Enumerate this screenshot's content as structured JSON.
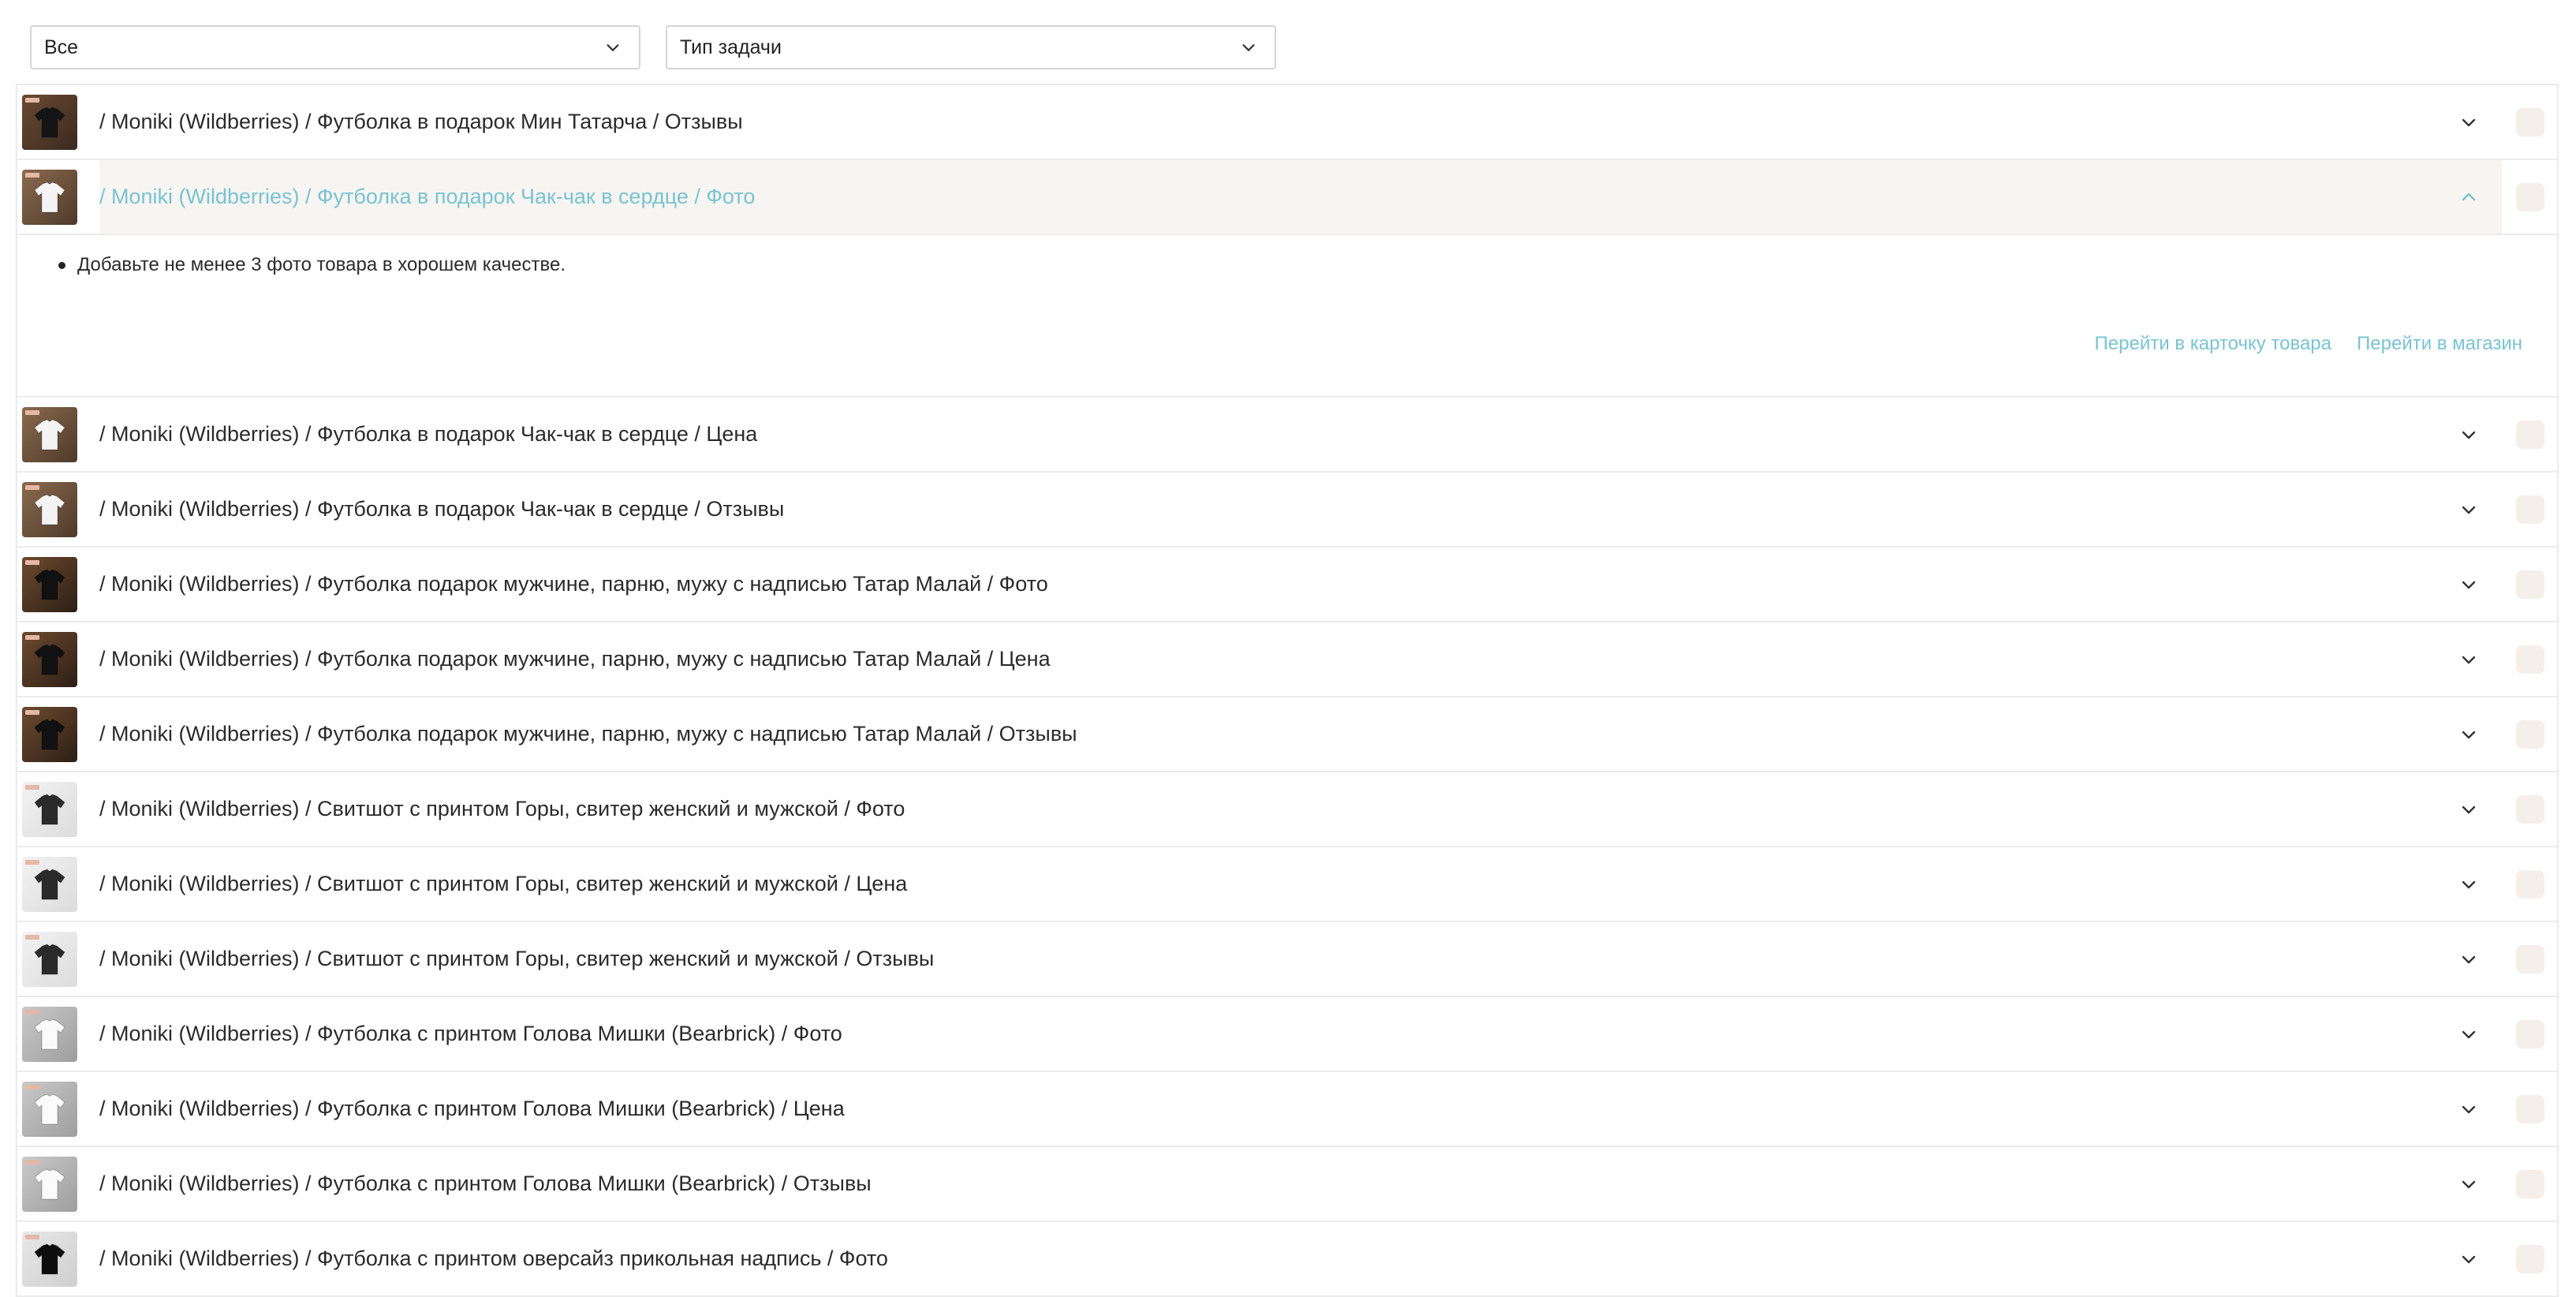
{
  "filters": {
    "status": {
      "value": "Все"
    },
    "task_type": {
      "value": "Тип задачи"
    }
  },
  "rows": [
    {
      "title": "/ Moniki (Wildberries) / Футболка в подарок Мин Татарча / Отзывы",
      "thumb": "dark-tshirt"
    },
    {
      "title": "/ Moniki (Wildberries) / Футболка в подарок Чак-чак в сердце / Фото",
      "thumb": "white-tshirt",
      "expanded": true,
      "details": [
        "Добавьте не менее 3 фото товара в хорошем качестве."
      ],
      "links": {
        "card": "Перейти в карточку товара",
        "shop": "Перейти в магазин"
      }
    },
    {
      "title": "/ Moniki (Wildberries) / Футболка в подарок Чак-чак в сердце / Цена",
      "thumb": "white-tshirt"
    },
    {
      "title": "/ Moniki (Wildberries) / Футболка в подарок Чак-чак в сердце / Отзывы",
      "thumb": "white-tshirt"
    },
    {
      "title": "/ Moniki (Wildberries) / Футболка подарок мужчине, парню, мужу с надписью Татар Малай / Фото",
      "thumb": "black-tshirt"
    },
    {
      "title": "/ Moniki (Wildberries) / Футболка подарок мужчине, парню, мужу с надписью Татар Малай / Цена",
      "thumb": "black-tshirt"
    },
    {
      "title": "/ Moniki (Wildberries) / Футболка подарок мужчине, парню, мужу с надписью Татар Малай / Отзывы",
      "thumb": "black-tshirt"
    },
    {
      "title": "/ Moniki (Wildberries) / Свитшот с принтом Горы, свитер женский и мужской / Фото",
      "thumb": "sweatshirt"
    },
    {
      "title": "/ Moniki (Wildberries) / Свитшот с принтом Горы, свитер женский и мужской / Цена",
      "thumb": "sweatshirt"
    },
    {
      "title": "/ Moniki (Wildberries) / Свитшот с принтом Горы, свитер женский и мужской / Отзывы",
      "thumb": "sweatshirt"
    },
    {
      "title": "/ Moniki (Wildberries) / Футболка с принтом Голова Мишки (Bearbrick) / Фото",
      "thumb": "bear-tshirt"
    },
    {
      "title": "/ Moniki (Wildberries) / Футболка с принтом Голова Мишки (Bearbrick) / Цена",
      "thumb": "bear-tshirt"
    },
    {
      "title": "/ Moniki (Wildberries) / Футболка с принтом Голова Мишки (Bearbrick) / Отзывы",
      "thumb": "bear-tshirt"
    },
    {
      "title": "/ Moniki (Wildberries) / Футболка с принтом оверсайз прикольная надпись / Фото",
      "thumb": "oversize-tshirt"
    }
  ],
  "colors": {
    "accent": "#79c3d3",
    "expanded_bg": "#f7f5f1",
    "checkbox": "#f4efea",
    "divider": "#ececec"
  }
}
